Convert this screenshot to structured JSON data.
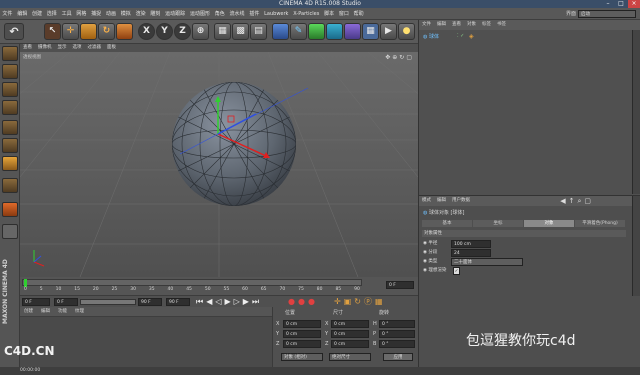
{
  "window": {
    "title": "CINEMA 4D R15.008 Studio",
    "min": "–",
    "max": "□",
    "close": "×"
  },
  "menu": [
    "文件",
    "编辑",
    "创建",
    "选择",
    "工具",
    "网格",
    "捕捉",
    "动画",
    "模拟",
    "渲染",
    "雕刻",
    "运动跟踪",
    "运动图形",
    "角色",
    "流水线",
    "插件",
    "Laubwerk",
    "X-Particles",
    "脚本",
    "窗口",
    "帮助"
  ],
  "layout": {
    "label": "界面",
    "value": "启动"
  },
  "toolbar": {
    "undo": "↶",
    "x": "X",
    "y": "Y",
    "z": "Z"
  },
  "viewport": {
    "menu": [
      "查看",
      "摄像机",
      "显示",
      "选项",
      "过滤器",
      "面板"
    ],
    "label": "透视视图"
  },
  "timeline": {
    "ticks": [
      "0",
      "5",
      "10",
      "15",
      "20",
      "25",
      "30",
      "35",
      "40",
      "45",
      "50",
      "55",
      "60",
      "65",
      "70",
      "75",
      "80",
      "85",
      "90"
    ],
    "frame_end": "0 F"
  },
  "transport": {
    "start": "0 F",
    "field2": "0 F",
    "end": "90 F",
    "end2": "90 F"
  },
  "materials": {
    "menu": [
      "创建",
      "编辑",
      "功能",
      "纹理"
    ]
  },
  "coords": {
    "headers": [
      "位置",
      "尺寸",
      "旋转"
    ],
    "rows": [
      {
        "axis": "X",
        "pos": "0 cm",
        "axis2": "X",
        "size": "0 cm",
        "rot_axis": "H",
        "rot": "0 °"
      },
      {
        "axis": "Y",
        "pos": "0 cm",
        "axis2": "Y",
        "size": "0 cm",
        "rot_axis": "P",
        "rot": "0 °"
      },
      {
        "axis": "Z",
        "pos": "0 cm",
        "axis2": "Z",
        "size": "0 cm",
        "rot_axis": "B",
        "rot": "0 °"
      }
    ],
    "mode": "对象 (相对)",
    "size_mode": "绝对尺寸",
    "apply": "应用"
  },
  "objects": {
    "menu": [
      "文件",
      "编辑",
      "查看",
      "对象",
      "标签",
      "书签"
    ],
    "items": [
      {
        "name": "球体"
      }
    ]
  },
  "attributes": {
    "menu": [
      "模式",
      "编辑",
      "用户数据"
    ],
    "object_title": "球体对象 [球体]",
    "tabs": [
      "基本",
      "坐标",
      "对象",
      "平滑着色(Phong)"
    ],
    "active_tab": "对象",
    "section": "对象属性",
    "fields": [
      {
        "label": "半径",
        "value": "100 cm"
      },
      {
        "label": "分段",
        "value": "24"
      },
      {
        "label": "类型",
        "value": "二十面体"
      },
      {
        "label": "理想渲染",
        "value": "✓"
      }
    ]
  },
  "brand": {
    "vertical": "MAXON CINEMA 4D",
    "site": "C4D.CN",
    "watermark": "包逗猩教你玩c4d"
  },
  "status": {
    "text": "00:00:00"
  }
}
